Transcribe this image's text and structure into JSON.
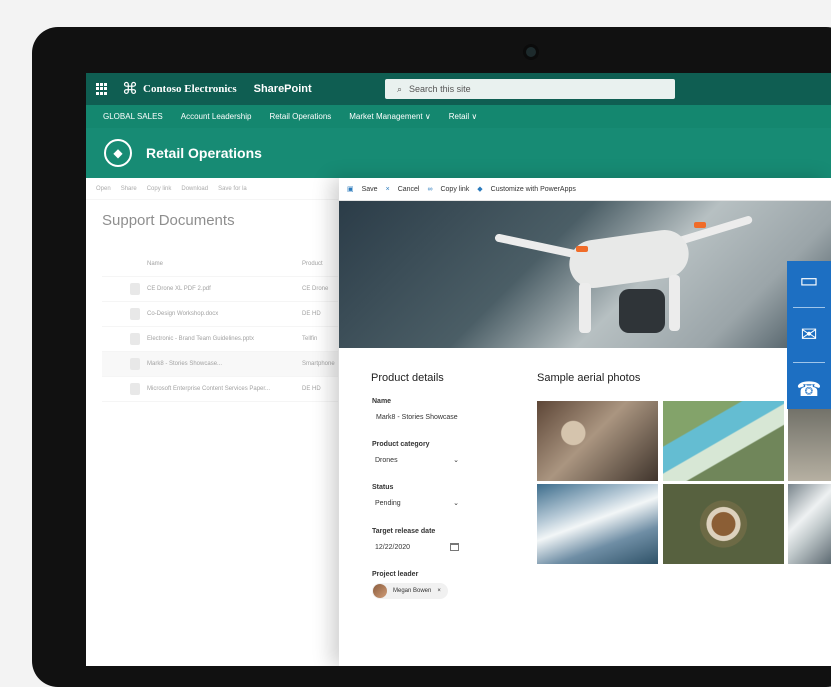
{
  "suitebar": {
    "brand": "Contoso Electronics",
    "app": "SharePoint",
    "search_placeholder": "Search this site"
  },
  "nav": {
    "items": [
      "GLOBAL SALES",
      "Account Leadership",
      "Retail Operations",
      "Market Management ∨",
      "Retail ∨"
    ]
  },
  "site": {
    "title": "Retail Operations"
  },
  "list": {
    "commands": [
      "Open",
      "Share",
      "Copy link",
      "Download",
      "Save for la"
    ],
    "title": "Support Documents",
    "columns": [
      "Name",
      "Product"
    ],
    "rows": [
      {
        "name": "CE Drone XL PDF 2.pdf",
        "product": "CE Drone"
      },
      {
        "name": "Co-Design Workshop.docx",
        "product": "DE HD"
      },
      {
        "name": "Electronic - Brand Team Guidelines.pptx",
        "product": "Tellfin"
      },
      {
        "name": "Mark8 - Stories Showcase...",
        "product": "Smartphone"
      },
      {
        "name": "Microsoft Enterprise Content Services Paper...",
        "product": "DE HD"
      }
    ]
  },
  "panel": {
    "commands": [
      "Save",
      "Cancel",
      "Copy link",
      "Customize with PowerApps"
    ],
    "details_title": "Product details",
    "name_label": "Name",
    "name_value": "Mark8 - Stories Showcase",
    "category_label": "Product category",
    "category_value": "Drones",
    "status_label": "Status",
    "status_value": "Pending",
    "date_label": "Target release date",
    "date_value": "12/22/2020",
    "leader_label": "Project leader",
    "leader_value": "Megan Bowen",
    "photos_title": "Sample aerial photos"
  },
  "icons": {
    "chat": "chat-icon",
    "mail": "mail-icon",
    "phone": "phone-icon"
  },
  "colors": {
    "suitebar": "#0f5e52",
    "nav": "#14876f",
    "header": "#178b74",
    "contact": "#1d6fc2"
  }
}
